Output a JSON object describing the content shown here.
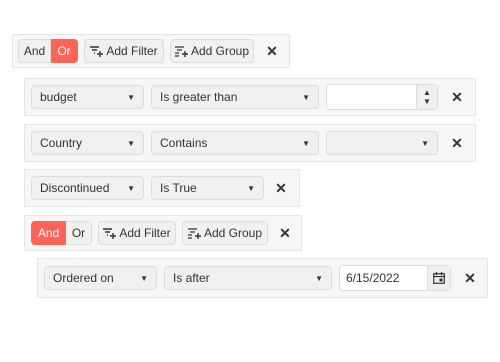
{
  "root_group": {
    "and_label": "And",
    "or_label": "Or",
    "active_logic": "Or",
    "add_filter_label": "Add Filter",
    "add_group_label": "Add Group"
  },
  "filters": [
    {
      "field": "budget",
      "operator": "Is greater than",
      "value": ""
    },
    {
      "field": "Country",
      "operator": "Contains",
      "value": ""
    },
    {
      "field": "Discontinued",
      "operator": "Is True"
    }
  ],
  "nested_group": {
    "and_label": "And",
    "or_label": "Or",
    "active_logic": "And",
    "add_filter_label": "Add Filter",
    "add_group_label": "Add Group",
    "filters": [
      {
        "field": "Ordered on",
        "operator": "Is after",
        "value": "6/15/2022"
      }
    ]
  },
  "colors": {
    "accent": "#ff6358",
    "panel": "#f6f6f6",
    "border": "#dcdcdc"
  }
}
